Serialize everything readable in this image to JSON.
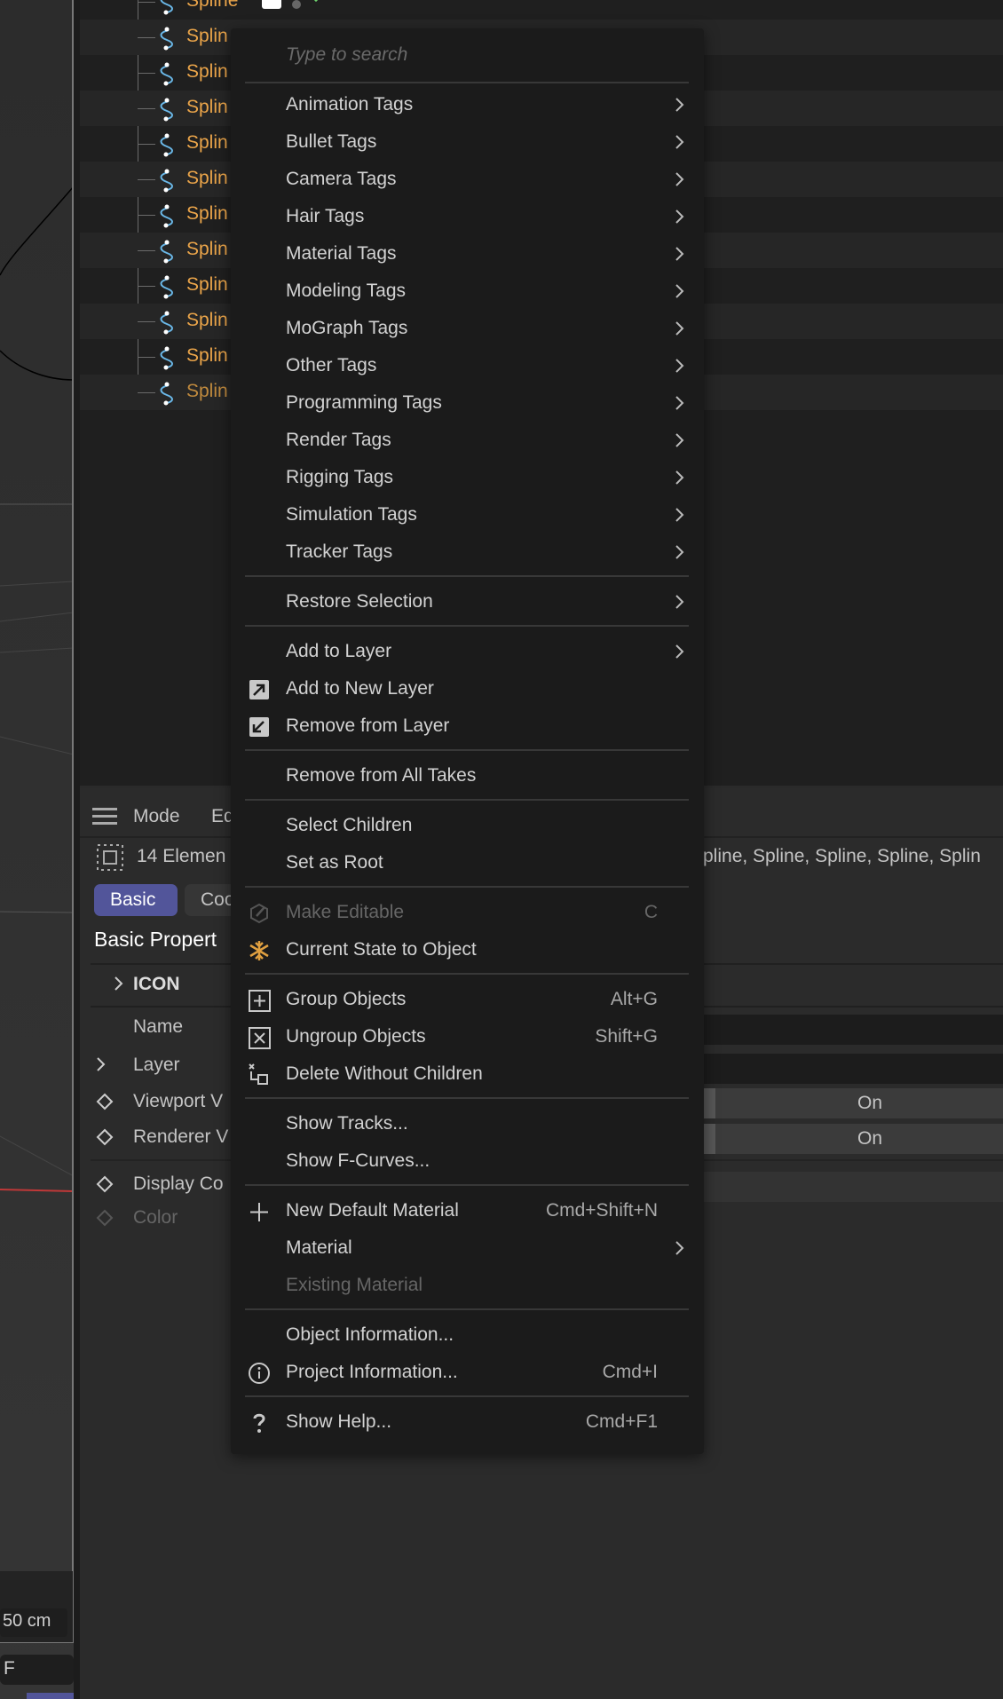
{
  "viewport": {
    "scale_label": "50 cm",
    "frame_label": "F"
  },
  "outliner": {
    "rows": [
      "Spline",
      "Splin",
      "Splin",
      "Splin",
      "Splin",
      "Splin",
      "Splin",
      "Splin",
      "Splin",
      "Splin",
      "Splin",
      "Splin"
    ]
  },
  "attributes": {
    "menu_label": "Mode",
    "edit_label": "Ed",
    "selection_count": "14 Elemen",
    "selection_names": "pline, Spline, Spline, Spline, Splin",
    "tabs": [
      "Basic",
      "Coo"
    ],
    "section_title": "Basic Propert",
    "group_label": "ICON",
    "props": [
      "Name",
      "Layer",
      "Viewport V",
      "Renderer V",
      "Display Co",
      "Color"
    ],
    "viewport_visibility": "On",
    "renderer_visibility": "On"
  },
  "menu": {
    "search_placeholder": "Type to search",
    "items": [
      {
        "label": "Animation Tags",
        "submenu": true
      },
      {
        "label": "Bullet Tags",
        "submenu": true
      },
      {
        "label": "Camera Tags",
        "submenu": true
      },
      {
        "label": "Hair Tags",
        "submenu": true
      },
      {
        "label": "Material Tags",
        "submenu": true
      },
      {
        "label": "Modeling Tags",
        "submenu": true
      },
      {
        "label": "MoGraph Tags",
        "submenu": true
      },
      {
        "label": "Other Tags",
        "submenu": true
      },
      {
        "label": "Programming Tags",
        "submenu": true
      },
      {
        "label": "Render Tags",
        "submenu": true
      },
      {
        "label": "Rigging Tags",
        "submenu": true
      },
      {
        "label": "Simulation Tags",
        "submenu": true
      },
      {
        "label": "Tracker Tags",
        "submenu": true
      },
      {
        "separator": true
      },
      {
        "label": "Restore Selection",
        "submenu": true
      },
      {
        "separator": true
      },
      {
        "label": "Add to Layer",
        "submenu": true
      },
      {
        "label": "Add to New Layer",
        "icon": "add-to-layer-icon"
      },
      {
        "label": "Remove from Layer",
        "icon": "remove-from-layer-icon"
      },
      {
        "separator": true
      },
      {
        "label": "Remove from All Takes"
      },
      {
        "separator": true
      },
      {
        "label": "Select Children"
      },
      {
        "label": "Set as Root"
      },
      {
        "separator": true
      },
      {
        "label": "Make Editable",
        "icon": "make-editable-icon",
        "shortcut": "C",
        "disabled": true
      },
      {
        "label": "Current State to Object",
        "icon": "snowflake-icon"
      },
      {
        "separator": true
      },
      {
        "label": "Group Objects",
        "icon": "group-icon",
        "shortcut": "Alt+G"
      },
      {
        "label": "Ungroup Objects",
        "icon": "ungroup-icon",
        "shortcut": "Shift+G"
      },
      {
        "label": "Delete Without Children",
        "icon": "delete-without-children-icon"
      },
      {
        "separator": true
      },
      {
        "label": "Show Tracks..."
      },
      {
        "label": "Show F-Curves..."
      },
      {
        "separator": true
      },
      {
        "label": "New Default Material",
        "icon": "plus-icon",
        "shortcut": "Cmd+Shift+N"
      },
      {
        "label": "Material",
        "submenu": true
      },
      {
        "label": "Existing Material",
        "disabled": true
      },
      {
        "separator": true
      },
      {
        "label": "Object Information..."
      },
      {
        "label": "Project Information...",
        "icon": "info-icon",
        "shortcut": "Cmd+I"
      },
      {
        "separator": true
      },
      {
        "label": "Show Help...",
        "icon": "help-icon",
        "shortcut": "Cmd+F1"
      }
    ]
  },
  "colors": {
    "object_name": "#eba54a",
    "accent_tab": "#52559a",
    "snowflake": "#e0a040"
  }
}
